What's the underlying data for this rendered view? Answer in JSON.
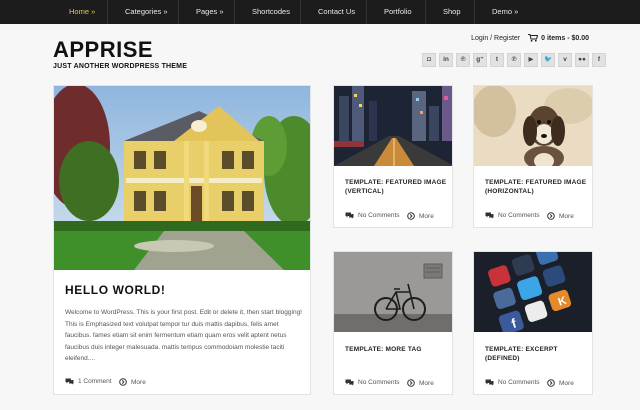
{
  "nav": {
    "items": [
      {
        "label": "Home »",
        "active": true
      },
      {
        "label": "Categories »",
        "active": false
      },
      {
        "label": "Pages »",
        "active": false
      },
      {
        "label": "Shortcodes",
        "active": false
      },
      {
        "label": "Contact Us",
        "active": false
      },
      {
        "label": "Portfolio",
        "active": false
      },
      {
        "label": "Shop",
        "active": false
      },
      {
        "label": "Demo »",
        "active": false
      }
    ]
  },
  "header": {
    "site_title": "APPRISE",
    "tagline": "JUST ANOTHER WORDPRESS THEME",
    "login_label": "Login / Register",
    "cart_label": "0 items - $0.00"
  },
  "social": [
    "instagram-icon",
    "linkedin-icon",
    "pinterest-icon",
    "google-plus-icon",
    "tumblr-icon",
    "pinterest-alt-icon",
    "youtube-icon",
    "twitter-icon",
    "vimeo-icon",
    "flickr-icon",
    "facebook-icon"
  ],
  "social_glyphs": [
    "◘",
    "in",
    "℗",
    "g⁺",
    "t",
    "℗",
    "▶",
    "🐦",
    "v",
    "●●",
    "f"
  ],
  "posts": {
    "featured": {
      "title": "HELLO WORLD!",
      "excerpt": "Welcome to WordPress. This is your first post. Edit or delete it, then start blogging! This is Emphasized text volutpat tempor tur duis mattis dapibus, felis amet faucibus. fames etiam sit enim fermentum etiam quam eros velit aptent netus faucibus duis integer malesuada. mattis tempus commodoiam molestie taciti eleifend....",
      "comments": "1 Comment",
      "more": "More"
    },
    "grid": [
      {
        "title_line1": "TEMPLATE: FEATURED IMAGE",
        "title_line2": "(VERTICAL)",
        "comments": "No Comments",
        "more": "More"
      },
      {
        "title_line1": "TEMPLATE: FEATURED IMAGE",
        "title_line2": "(HORIZONTAL)",
        "comments": "No Comments",
        "more": "More"
      },
      {
        "title_line1": "TEMPLATE: MORE TAG",
        "title_line2": "",
        "comments": "No Comments",
        "more": "More"
      },
      {
        "title_line1": "TEMPLATE: EXCERPT",
        "title_line2": "(DEFINED)",
        "comments": "No Comments",
        "more": "More"
      }
    ]
  },
  "colors": {
    "nav_bg": "#1c1c1c",
    "nav_active": "#f0c24a",
    "page_bg": "#f7f7f7"
  }
}
